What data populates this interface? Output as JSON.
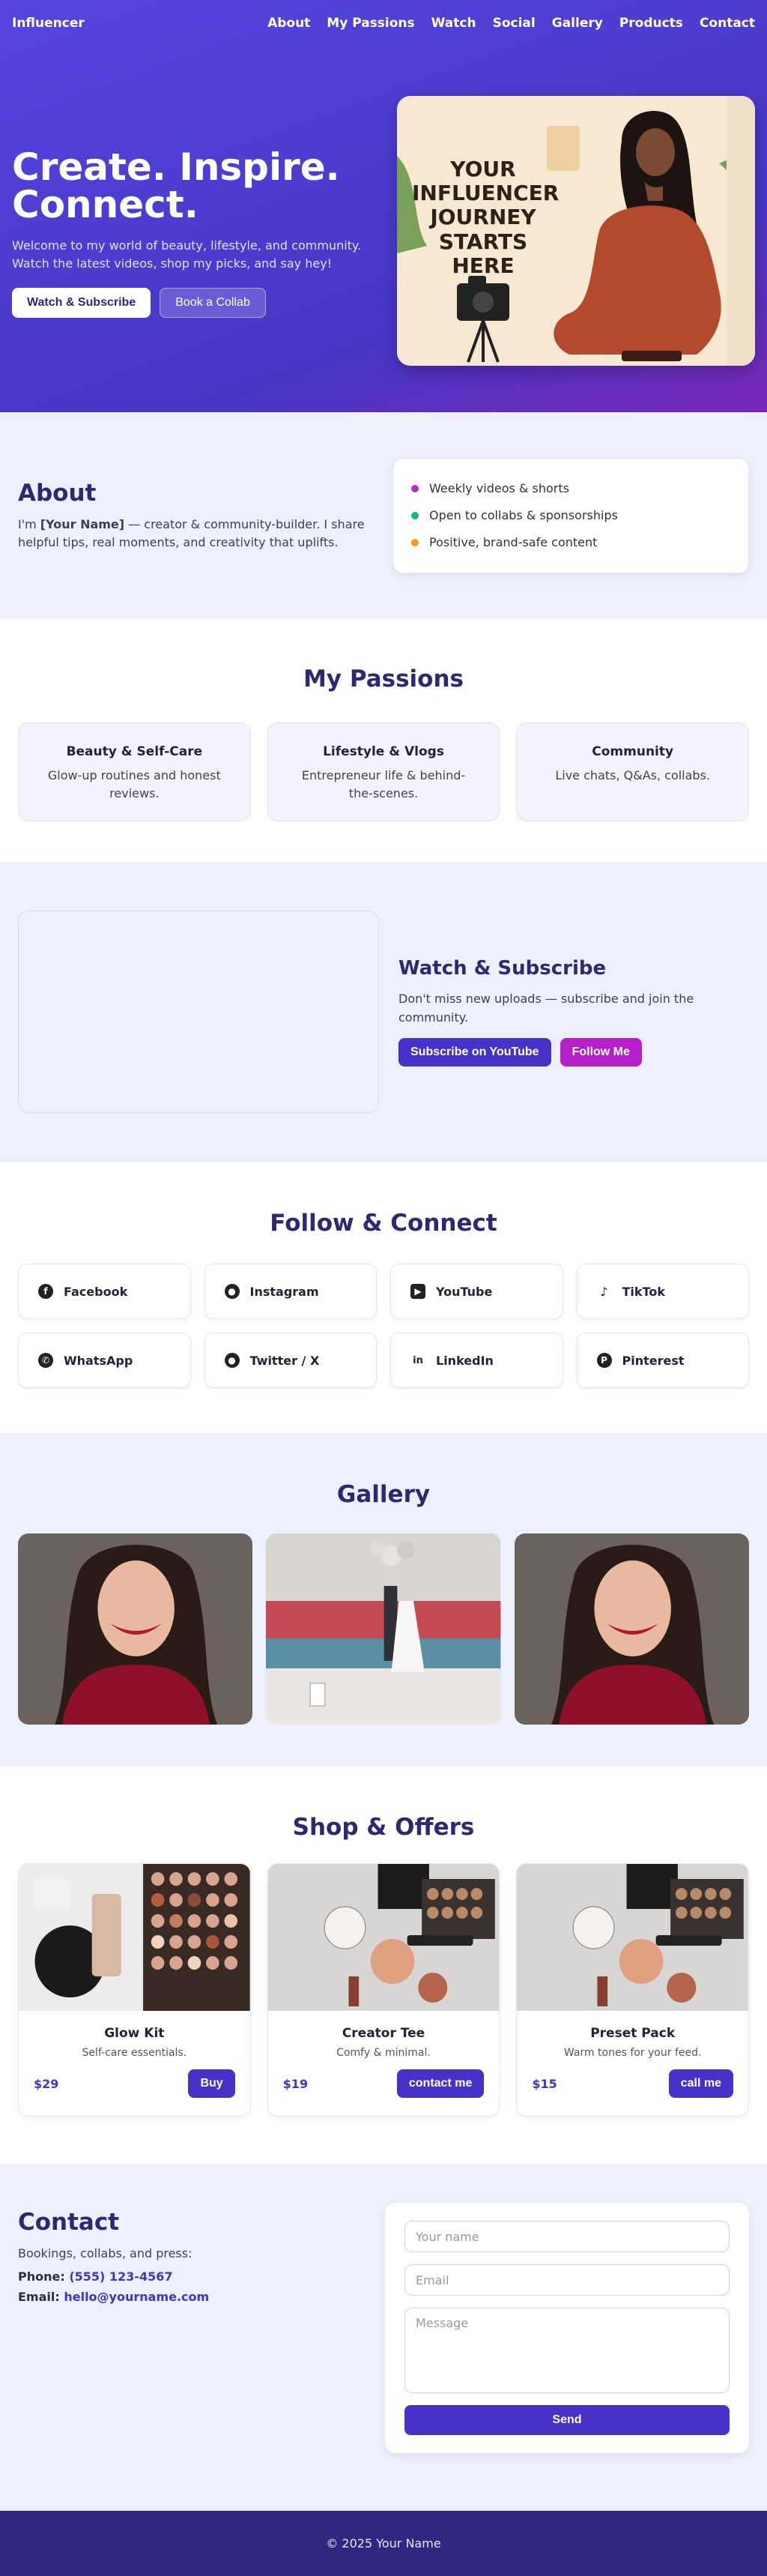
{
  "nav": {
    "brand": "Influencer",
    "links": [
      "About",
      "My Passions",
      "Watch",
      "Social",
      "Gallery",
      "Products",
      "Contact"
    ]
  },
  "hero": {
    "title_line1": "Create. Inspire.",
    "title_line2": "Connect.",
    "text": "Welcome to my world of beauty, lifestyle, and community. Watch the latest videos, shop my picks, and say hey!",
    "btn_primary": "Watch & Subscribe",
    "btn_secondary": "Book a Collab",
    "poster_line1": "YOUR",
    "poster_line2": "INFLUENCER",
    "poster_line3": "JOURNEY",
    "poster_line4": "STARTS HERE"
  },
  "about": {
    "title": "About",
    "text_pre": "I'm ",
    "text_name": "[Your Name]",
    "text_post": " — creator & community-builder. I share helpful tips, real moments, and creativity that uplifts.",
    "items": [
      {
        "label": "Weekly videos & shorts",
        "color": "#c026d3"
      },
      {
        "label": "Open to collabs & sponsorships",
        "color": "#10b981"
      },
      {
        "label": "Positive, brand-safe content",
        "color": "#f59e0b"
      }
    ]
  },
  "passions": {
    "title": "My Passions",
    "cards": [
      {
        "title": "Beauty & Self-Care",
        "text": "Glow-up routines and honest reviews."
      },
      {
        "title": "Lifestyle & Vlogs",
        "text": "Entrepreneur life & behind-the-scenes."
      },
      {
        "title": "Community",
        "text": "Live chats, Q&As, collabs."
      }
    ]
  },
  "watch": {
    "title": "Watch & Subscribe",
    "text": "Don't miss new uploads — subscribe and join the community.",
    "btn_youtube": "Subscribe on YouTube",
    "btn_follow": "Follow Me"
  },
  "social": {
    "title": "Follow & Connect",
    "items": [
      {
        "label": "Facebook",
        "icon": "facebook-icon",
        "glyph": "f"
      },
      {
        "label": "Instagram",
        "icon": "github-icon",
        "glyph": "●"
      },
      {
        "label": "YouTube",
        "icon": "youtube-icon",
        "glyph": "▶"
      },
      {
        "label": "TikTok",
        "icon": "tiktok-icon",
        "glyph": "♪"
      },
      {
        "label": "WhatsApp",
        "icon": "whatsapp-icon",
        "glyph": "✆"
      },
      {
        "label": "Twitter / X",
        "icon": "github-icon",
        "glyph": "●"
      },
      {
        "label": "LinkedIn",
        "icon": "linkedin-icon",
        "glyph": "in"
      },
      {
        "label": "Pinterest",
        "icon": "pinterest-icon",
        "glyph": "P"
      }
    ]
  },
  "gallery": {
    "title": "Gallery"
  },
  "shop": {
    "title": "Shop & Offers",
    "items": [
      {
        "name": "Glow Kit",
        "desc": "Self-care essentials.",
        "price": "$29",
        "cta": "Buy"
      },
      {
        "name": "Creator Tee",
        "desc": "Comfy & minimal.",
        "price": "$19",
        "cta": "contact me"
      },
      {
        "name": "Preset Pack",
        "desc": "Warm tones for your feed.",
        "price": "$15",
        "cta": "call me"
      }
    ]
  },
  "contact": {
    "title": "Contact",
    "text": "Bookings, collabs, and press:",
    "phone_label": "Phone:",
    "phone": "(555) 123-4567",
    "email_label": "Email:",
    "email": "hello@yourname.com",
    "name_ph": "Your name",
    "email_ph": "Email",
    "message_ph": "Message",
    "send": "Send"
  },
  "footer": {
    "text": "© 2025 Your Name"
  }
}
